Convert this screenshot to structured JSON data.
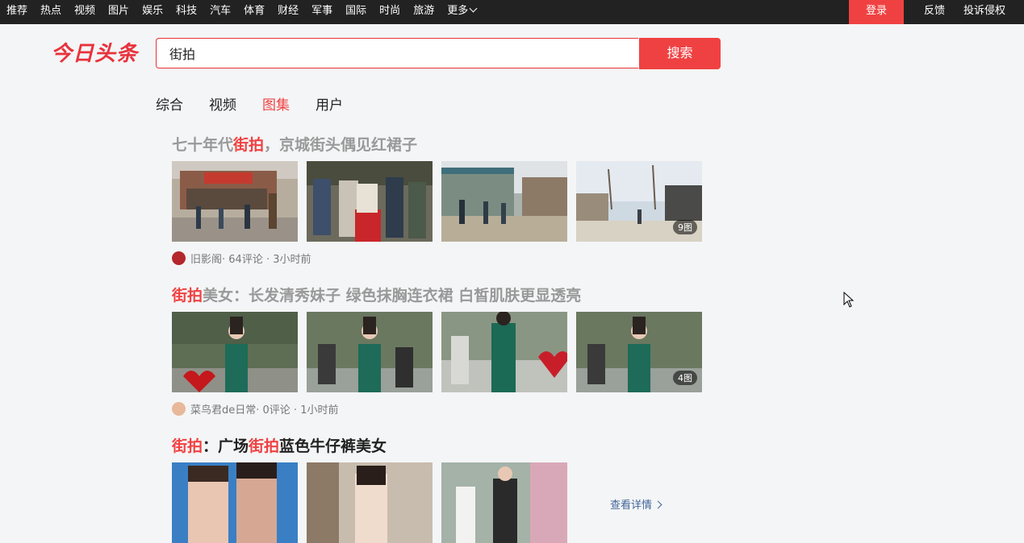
{
  "topnav": {
    "items": [
      "推荐",
      "热点",
      "视频",
      "图片",
      "娱乐",
      "科技",
      "汽车",
      "体育",
      "财经",
      "军事",
      "国际",
      "时尚",
      "旅游",
      "更多"
    ],
    "login": "登录",
    "feedback": "反馈",
    "complain": "投诉侵权"
  },
  "logo": "今日头条",
  "search": {
    "value": "街拍",
    "button": "搜索"
  },
  "tabs": [
    {
      "label": "综合",
      "active": false
    },
    {
      "label": "视频",
      "active": false
    },
    {
      "label": "图集",
      "active": true
    },
    {
      "label": "用户",
      "active": false
    }
  ],
  "results": [
    {
      "title_pre": "七十年代",
      "title_hl": "街拍",
      "title_post": "，京城街头偶见红裙子",
      "image_count": "9图",
      "author": "旧影阁",
      "stats": " · 64评论 · 3小时前"
    },
    {
      "title_hl": "街拍",
      "title_post": "美女：长发清秀妹子 绿色抹胸连衣裙 白皙肌肤更显透亮",
      "image_count": "4图",
      "author": "菜鸟君de日常",
      "stats": " · 0评论 · 1小时前"
    },
    {
      "title_hl": "街拍",
      "title_mid": "：广场",
      "title_hl2": "街拍",
      "title_post": "蓝色牛仔裤美女"
    }
  ],
  "view_detail": "查看详情",
  "colors": {
    "accent": "#f04142",
    "topbar": "#222222",
    "link": "#406599"
  }
}
